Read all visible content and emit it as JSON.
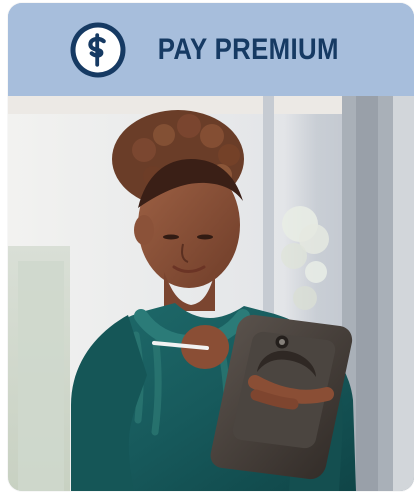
{
  "card": {
    "title": "PAY PREMIUM",
    "icon": "dollar-circle-icon",
    "colors": {
      "header_bg": "#a7bedc",
      "brand": "#163a63",
      "icon_fill": "#ffffff"
    }
  },
  "image": {
    "subject": "woman-with-tablet"
  }
}
